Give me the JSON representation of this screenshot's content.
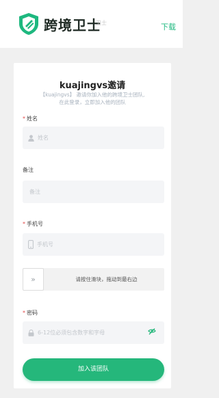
{
  "header": {
    "brand_name": "跨境卫士",
    "brand_sub": "卫士",
    "download_label": "下载"
  },
  "form": {
    "title": "kuajingvs邀请",
    "subtitle_line1": "【kuajingvs】 邀请你加入他的跨境卫士团队,",
    "subtitle_line2": "在此登录，立即加入他的团队",
    "name_label": "姓名",
    "name_placeholder": "姓名",
    "remark_label": "备注",
    "remark_placeholder": "备注",
    "phone_label": "手机号",
    "phone_placeholder": "手机号",
    "slider_text": "请按住滑块，拖动到最右边",
    "slider_handle": "»",
    "password_label": "密码",
    "password_placeholder": "6-12位必须包含数字和字母",
    "submit_label": "加入该团队",
    "required_mark": "*"
  },
  "colors": {
    "accent": "#25b77b",
    "brand_dark": "#1f2a24",
    "required": "#e24c4c"
  },
  "icons": {
    "logo": "shield-logo-icon",
    "name": "user-icon",
    "phone": "phone-icon",
    "password": "lock-icon",
    "visibility": "eye-toggle-icon",
    "slider": "double-chevron-right-icon"
  }
}
